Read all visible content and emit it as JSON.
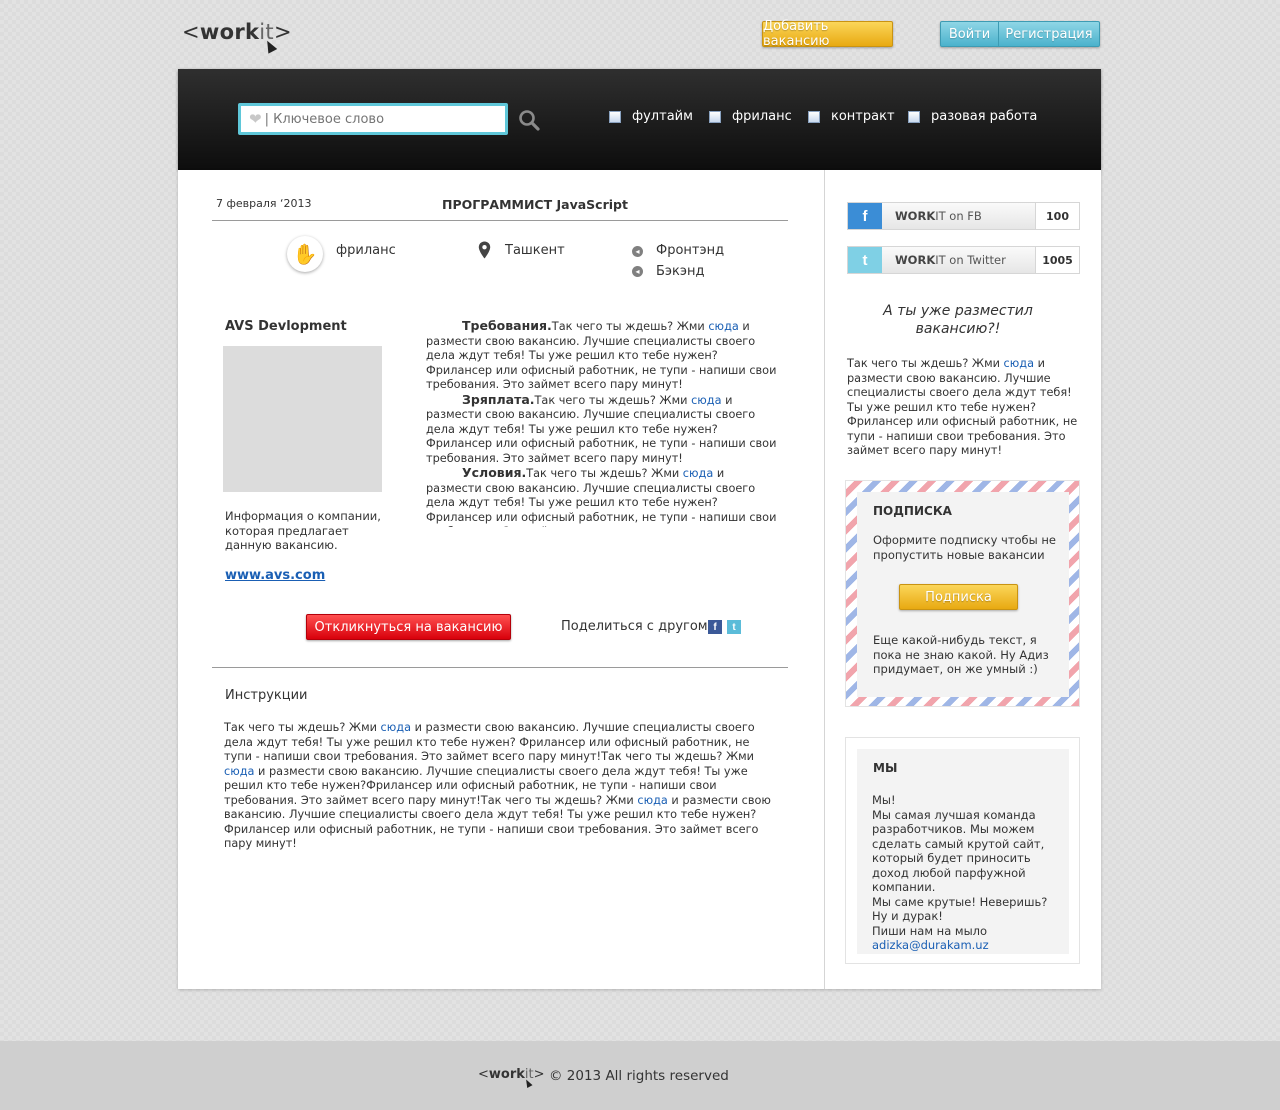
{
  "header": {
    "logo": {
      "open": "<",
      "brand": "work",
      "thin": "it",
      "close": ">"
    },
    "add_vacancy": "Добавить вакансию",
    "login": "Войти",
    "register": "Регистрация"
  },
  "search": {
    "placeholder": "| Ключевое слово",
    "filters": [
      "фултайм",
      "фриланс",
      "контракт",
      "разовая работа"
    ]
  },
  "vacancy": {
    "date": "7 февраля ‘2013",
    "title": "ПРОГРАММИСТ JavaScript",
    "employment": "фриланс",
    "location": "Ташкент",
    "categories": [
      "Фронтэнд",
      "Бэкэнд"
    ],
    "company": {
      "name": "AVS Devlopment",
      "info": "Информация о компании, которая предлагает данную вакансию.",
      "link": "www.avs.com"
    },
    "sections": [
      {
        "heading": "Требования.",
        "text_before": "Так чего ты ждешь? Жми ",
        "link": "сюда",
        "text_after": " и размести свою вакансию. Лучшие специалисты своего дела ждут тебя! Ты уже решил кто тебе нужен? Фрилансер или офисный работник, не тупи - напиши свои требования. Это займет всего пару минут!"
      },
      {
        "heading": "Зряплата.",
        "text_before": "Так чего ты ждешь? Жми ",
        "link": "сюда",
        "text_after": " и размести свою вакансию. Лучшие специалисты своего дела ждут тебя! Ты уже решил кто тебе нужен? Фрилансер или офисный работник, не тупи - напиши свои требования. Это займет всего пару минут!"
      },
      {
        "heading": "Условия.",
        "text_before": "Так чего ты ждешь? Жми ",
        "link": "сюда",
        "text_after": " и размести свою вакансию. Лучшие специалисты своего дела ждут тебя! Ты уже решил кто тебе нужен? Фрилансер или офисный работник, не тупи - напиши свои требования. Это займет всего"
      }
    ],
    "apply": "Откликнуться на вакансию",
    "share_label": "Поделиться с другом:",
    "instructions_title": "Инструкции",
    "instructions": [
      {
        "text": "Так чего ты ждешь? Жми ",
        "link": "сюда"
      },
      {
        "text": " и размести свою вакансию. Лучшие специалисты своего дела ждут тебя! Ты уже решил кто тебе нужен? Фрилансер или офисный работник, не тупи - напиши свои требования. Это займет всего пару минут!Так чего ты ждешь? Жми ",
        "link": "сюда"
      },
      {
        "text": " и размести свою вакансию. Лучшие специалисты своего дела ждут тебя! Ты уже решил кто тебе нужен?Фрилансер или офисный работник, не тупи - напиши свои требования. Это займет всего пару минут!Так чего ты ждешь? Жми ",
        "link": "сюда"
      },
      {
        "text": " и размести свою вакансию. Лучшие специалисты своего дела ждут тебя! Ты уже решил кто тебе нужен? Фрилансер или офисный работник, не тупи - напиши свои требования. Это займет всего пару минут!",
        "link": ""
      }
    ]
  },
  "sidebar": {
    "social": [
      {
        "icon": "facebook-icon",
        "brand": "WORK",
        "thin": "IT",
        "label": " on FB",
        "count": "100",
        "color": "#3b8dd6"
      },
      {
        "icon": "twitter-icon",
        "brand": "WORK",
        "thin": "IT",
        "label": " on Twitter",
        "count": "1005",
        "color": "#7fd0e5"
      }
    ],
    "promo_title": "А ты уже разместил вакансию?!",
    "promo_text_before": "Так чего ты ждешь? Жми ",
    "promo_link": "сюда",
    "promo_text_after": " и размести свою вакансию. Лучшие специалисты своего дела ждут тебя! Ты уже решил кто тебе нужен? Фрилансер или офисный работник, не тупи - напиши свои требования. Это займет всего пару минут!",
    "subscription": {
      "title": "ПОДПИСКА",
      "text": "Оформите подписку чтобы не пропустить новые вакансии",
      "button": "Подписка",
      "extra": "Еще какой-нибудь текст, я пока не знаю какой.  Ну Адиз придумает, он же умный :)"
    },
    "about": {
      "title": "МЫ",
      "lines": [
        "Мы!",
        "Мы самая лучшая команда разработчиков. Мы можем сделать самый крутой сайт, который будет приносить доход любой парфужной компании.",
        "Мы саме крутые! Неверишь?",
        "Ну и дурак!",
        "Пиши нам на мыло"
      ],
      "email": "adizka@durakam.uz"
    }
  },
  "footer": {
    "copyright": "© 2013 All rights reserved"
  },
  "colors": {
    "accent_yellow": "#e8a911",
    "accent_blue": "#4bb2cc",
    "apply_red": "#d8000b",
    "link": "#1a5fb4"
  }
}
